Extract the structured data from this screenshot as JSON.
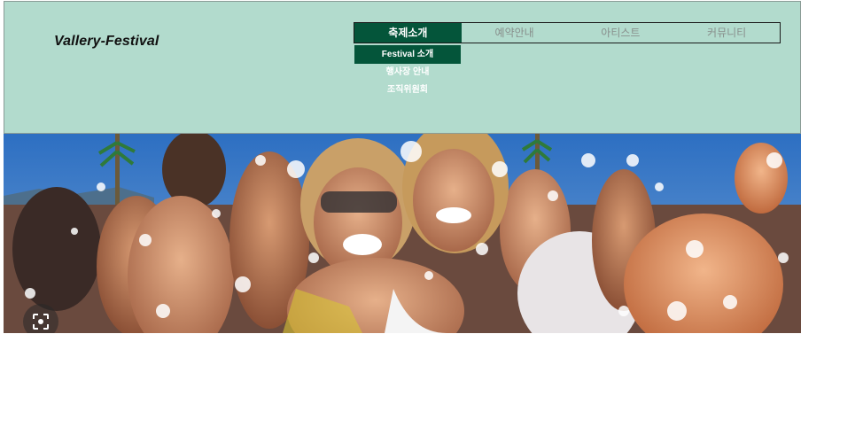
{
  "header": {
    "logo": "Vallery-Festival"
  },
  "nav": {
    "items": [
      {
        "label": "축제소개",
        "active": true
      },
      {
        "label": "예약안내",
        "active": false
      },
      {
        "label": "아티스트",
        "active": false
      },
      {
        "label": "커뮤니티",
        "active": false
      }
    ],
    "submenu": [
      {
        "label": "Festival 소개",
        "active": true
      },
      {
        "label": "행사장 안내",
        "active": false
      },
      {
        "label": "조직위원회",
        "active": false
      }
    ]
  },
  "hero": {
    "icon": "lens-search-icon"
  },
  "colors": {
    "header_bg": "#b2dbcd",
    "accent": "#04553a"
  }
}
